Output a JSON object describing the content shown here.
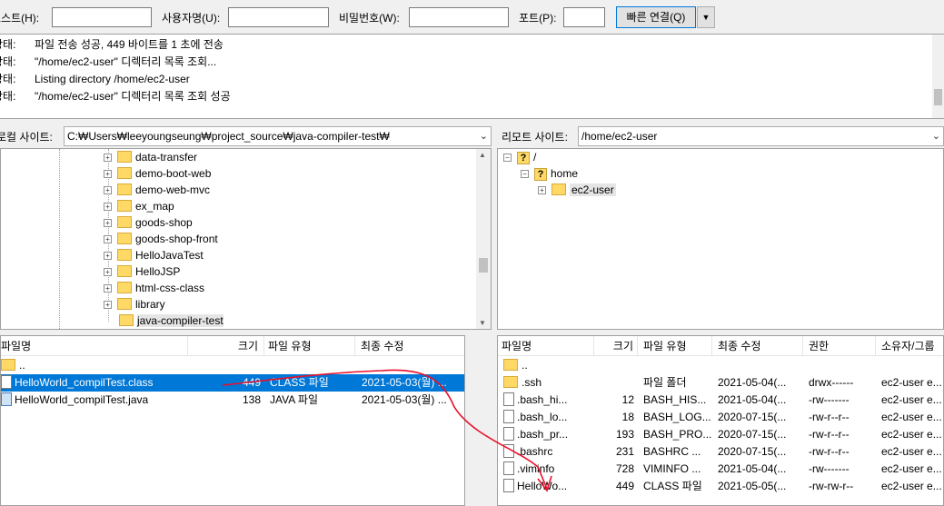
{
  "quickconnect": {
    "host_label": "호스트(H):",
    "user_label": "사용자명(U):",
    "pass_label": "비밀번호(W):",
    "port_label": "포트(P):",
    "connect_label": "빠른 연결(Q)",
    "dropdown_glyph": "▼"
  },
  "log": [
    {
      "key": "상태:",
      "msg": "파일 전송 성공, 449 바이트를 1 초에 전송"
    },
    {
      "key": "상태:",
      "msg": "\"/home/ec2-user\" 디렉터리 목록 조회..."
    },
    {
      "key": "상태:",
      "msg": "Listing directory /home/ec2-user"
    },
    {
      "key": "상태:",
      "msg": "\"/home/ec2-user\" 디렉터리 목록 조회 성공"
    }
  ],
  "local": {
    "site_label": "로컬 사이트:",
    "path": "C:₩Users₩leeyoungseung₩project_source₩java-compiler-test₩",
    "tree": [
      "data-transfer",
      "demo-boot-web",
      "demo-web-mvc",
      "ex_map",
      "goods-shop",
      "goods-shop-front",
      "HelloJavaTest",
      "HelloJSP",
      "html-css-class",
      "library",
      "java-compiler-test"
    ],
    "headers": {
      "name": "파일명",
      "size": "크기",
      "type": "파일 유형",
      "modified": "최종 수정"
    },
    "files": [
      {
        "name": "..",
        "size": "",
        "type": "",
        "modified": ""
      },
      {
        "name": "HelloWorld_compilTest.class",
        "size": "449",
        "type": "CLASS 파일",
        "modified": "2021-05-03(월) ..."
      },
      {
        "name": "HelloWorld_compilTest.java",
        "size": "138",
        "type": "JAVA 파일",
        "modified": "2021-05-03(월) ..."
      }
    ]
  },
  "remote": {
    "site_label": "리모트 사이트:",
    "path": "/home/ec2-user",
    "tree": [
      "/",
      "home",
      "ec2-user"
    ],
    "headers": {
      "name": "파일명",
      "size": "크기",
      "type": "파일 유형",
      "modified": "최종 수정",
      "perms": "권한",
      "owner": "소유자/그룹"
    },
    "files": [
      {
        "name": "..",
        "size": "",
        "type": "",
        "modified": "",
        "perms": "",
        "owner": ""
      },
      {
        "name": ".ssh",
        "size": "",
        "type": "파일 폴더",
        "modified": "2021-05-04(...",
        "perms": "drwx------",
        "owner": "ec2-user e..."
      },
      {
        "name": ".bash_hi...",
        "size": "12",
        "type": "BASH_HIS...",
        "modified": "2021-05-04(...",
        "perms": "-rw-------",
        "owner": "ec2-user e..."
      },
      {
        "name": ".bash_lo...",
        "size": "18",
        "type": "BASH_LOG...",
        "modified": "2020-07-15(...",
        "perms": "-rw-r--r--",
        "owner": "ec2-user e..."
      },
      {
        "name": ".bash_pr...",
        "size": "193",
        "type": "BASH_PRO...",
        "modified": "2020-07-15(...",
        "perms": "-rw-r--r--",
        "owner": "ec2-user e..."
      },
      {
        "name": ".bashrc",
        "size": "231",
        "type": "BASHRC ...",
        "modified": "2020-07-15(...",
        "perms": "-rw-r--r--",
        "owner": "ec2-user e..."
      },
      {
        "name": ".viminfo",
        "size": "728",
        "type": "VIMINFO ...",
        "modified": "2021-05-04(...",
        "perms": "-rw-------",
        "owner": "ec2-user e..."
      },
      {
        "name": "HelloWo...",
        "size": "449",
        "type": "CLASS 파일",
        "modified": "2021-05-05(...",
        "perms": "-rw-rw-r--",
        "owner": "ec2-user e..."
      }
    ]
  },
  "colors": {
    "selection": "#0078d7",
    "annotation": "#e8102a",
    "folder": "#ffd966"
  }
}
